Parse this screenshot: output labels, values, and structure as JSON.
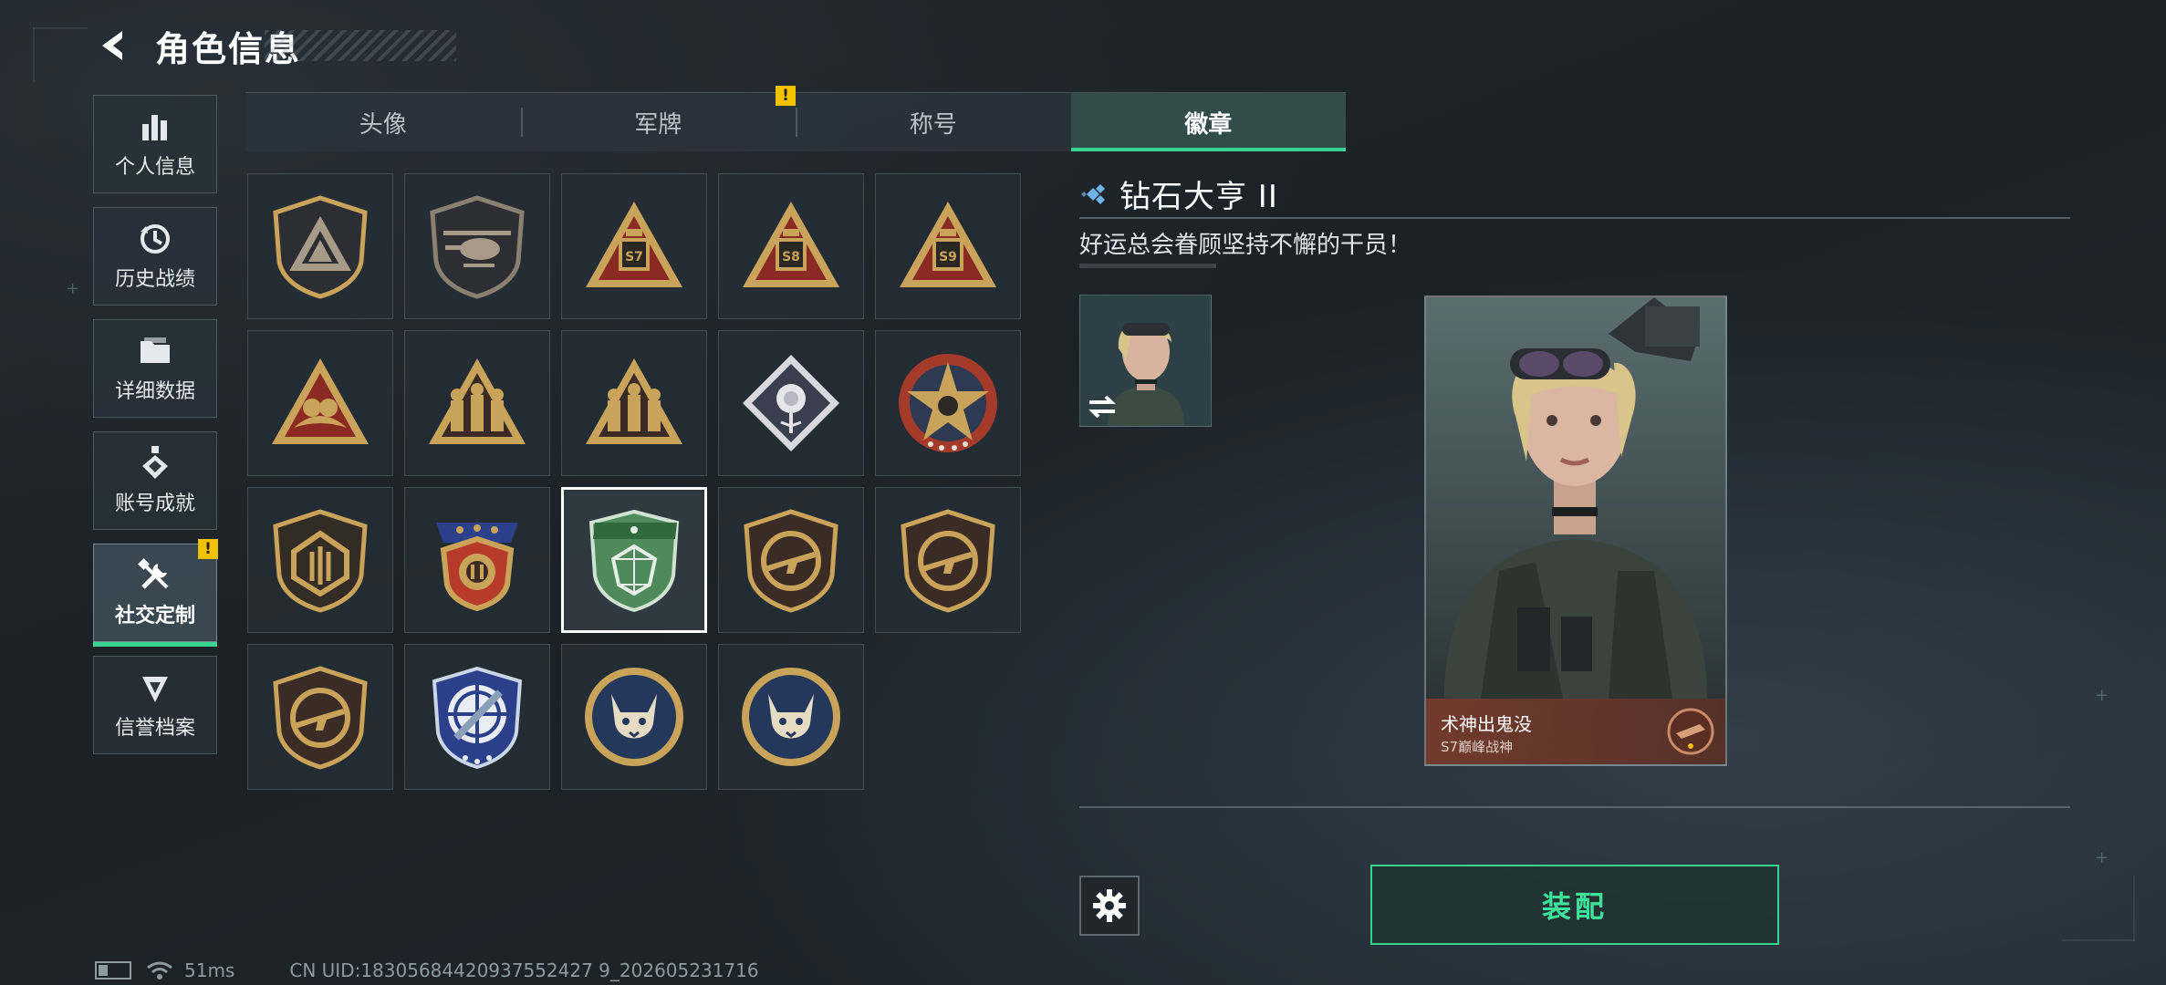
{
  "header": {
    "title": "角色信息",
    "back_icon": "back-arrow-icon"
  },
  "sidebar": {
    "items": [
      {
        "label": "个人信息",
        "icon": "bar-chart-icon",
        "active": false,
        "warning": false
      },
      {
        "label": "历史战绩",
        "icon": "history-icon",
        "active": false,
        "warning": false
      },
      {
        "label": "详细数据",
        "icon": "folder-icon",
        "active": false,
        "warning": false
      },
      {
        "label": "账号成就",
        "icon": "achievement-icon",
        "active": false,
        "warning": false
      },
      {
        "label": "社交定制",
        "icon": "tools-icon",
        "active": true,
        "warning": true
      },
      {
        "label": "信誉档案",
        "icon": "credit-icon",
        "active": false,
        "warning": false
      }
    ],
    "warning_mark": "!"
  },
  "tabs": {
    "items": [
      {
        "label": "头像",
        "active": false
      },
      {
        "label": "军牌",
        "active": false
      },
      {
        "label": "称号",
        "active": false
      },
      {
        "label": "徽章",
        "active": true
      }
    ],
    "warning_tab_index": 1,
    "warning_mark": "!"
  },
  "badges": [
    {
      "name": "triangle-shield-badge",
      "kind": "shield-triangle"
    },
    {
      "name": "helicopter-badge",
      "kind": "shield-heli"
    },
    {
      "name": "s7-tank-badge",
      "kind": "tri-s",
      "text": "S7"
    },
    {
      "name": "s8-tank-badge",
      "kind": "tri-s",
      "text": "S8"
    },
    {
      "name": "s9-heli-badge",
      "kind": "tri-s",
      "text": "S9"
    },
    {
      "name": "bird-triangle-badge",
      "kind": "tri-bird"
    },
    {
      "name": "soldiers-triangle-badge",
      "kind": "tri-soldiers"
    },
    {
      "name": "soldiers-gold-badge",
      "kind": "tri-soldiers"
    },
    {
      "name": "rose-diamond-badge",
      "kind": "diamond-rose"
    },
    {
      "name": "star-skull-badge",
      "kind": "circle-star"
    },
    {
      "name": "gold-shield-badge",
      "kind": "shield-gold"
    },
    {
      "name": "laurel-shield-badge",
      "kind": "shield-laurel"
    },
    {
      "name": "diamond-tycoon-badge",
      "kind": "shield-green"
    },
    {
      "name": "rifle-shield-badge",
      "kind": "shield-rifle"
    },
    {
      "name": "rifle-shield-badge-2",
      "kind": "shield-rifle"
    },
    {
      "name": "rifle-shield-badge-3",
      "kind": "shield-rifle"
    },
    {
      "name": "crosshair-knife-badge",
      "kind": "shield-crosshair"
    },
    {
      "name": "lynx-badge",
      "kind": "circle-lynx"
    },
    {
      "name": "lynx-badge-2",
      "kind": "circle-lynx"
    }
  ],
  "selected_badge_index": 12,
  "detail": {
    "name": "钻石大亨 II",
    "description": "好运总会眷顾坚持不懈的干员！",
    "card_name": "术神出鬼没",
    "card_subtitle": "S7巅峰战神",
    "equip_label": "装配"
  },
  "status": {
    "ping": "51ms",
    "uid": "CN UID:18305684420937552427 9_202605231716"
  },
  "colors": {
    "accent": "#37d38f",
    "warning": "#f2c200",
    "gold": "#c9a35a"
  }
}
